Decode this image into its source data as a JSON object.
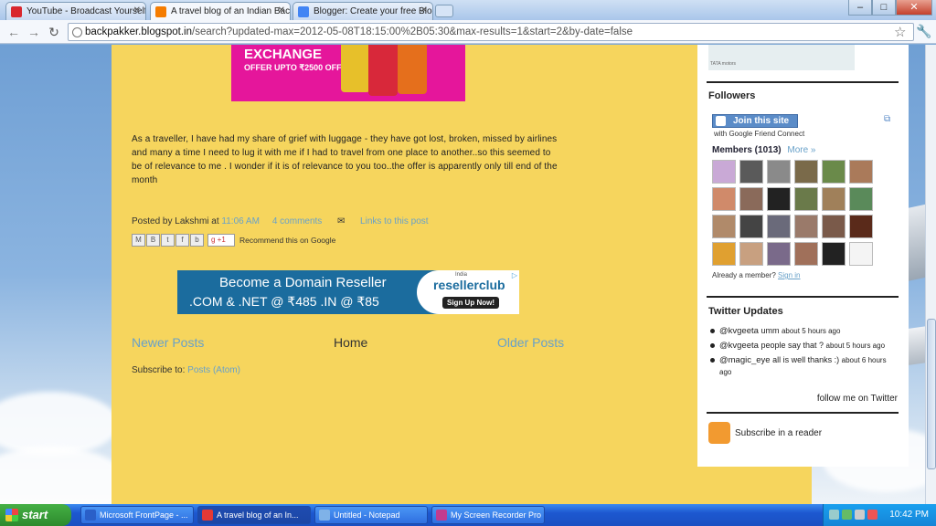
{
  "browser": {
    "tabs": [
      {
        "label": "YouTube - Broadcast Yourself",
        "color": "#d9272e"
      },
      {
        "label": "A travel blog of an Indian Backpacker",
        "color": "#f57c00"
      },
      {
        "label": "Blogger: Create your free Blog",
        "color": "#4285f4"
      }
    ],
    "url_host": "backpakker.blogspot.in",
    "url_path": "/search?updated-max=2012-05-08T18:15:00%2B05:30&max-results=1&start=2&by-date=false",
    "win_minimize": "–",
    "win_maximize": "□",
    "win_close": "✕"
  },
  "post": {
    "ad_top_title": "EXCHANGE",
    "ad_top_offer": "OFFER UPTO ₹2500 OFF*",
    "body": "As a traveller, I have had my share of grief with luggage - they have got lost, broken, missed by airlines and many a time I need to lug it with me if I had to travel from one place to another..so this seemed to be of relevance to me . I wonder if it is of relevance to you too..the offer is apparently only till end of the month",
    "posted_by_label": "Posted by",
    "author": "Lakshmi",
    "at": "at",
    "time": "11:06 AM",
    "comments": "4 comments",
    "links_to_post": "Links to this post",
    "recommend": "Recommend this on Google",
    "gplus": "+1"
  },
  "banner": {
    "line1": "Become a Domain Reseller",
    "line2": ".COM & .NET @ ₹485   .IN @ ₹85",
    "brand": "resellerclub",
    "brand_country": "India",
    "cta": "Sign Up Now!"
  },
  "pager": {
    "newer": "Newer Posts",
    "home": "Home",
    "older": "Older Posts"
  },
  "subscribe": {
    "label": "Subscribe to:",
    "link": "Posts (Atom)"
  },
  "sidebar": {
    "tata_caption": "TATA motors",
    "followers_title": "Followers",
    "join_label": "Join this site",
    "gfc_sub": "with Google Friend Connect",
    "members_label": "Members (1013)",
    "more_label": "More »",
    "already_member": "Already a member?",
    "sign_in": "Sign in",
    "twitter_title": "Twitter Updates",
    "tweets": [
      {
        "user": "@kvgeeta",
        "text": "umm",
        "ago": "about 5 hours ago"
      },
      {
        "user": "@kvgeeta",
        "text": "people say that ?",
        "ago": "about 5 hours ago"
      },
      {
        "user": "@magic_eye",
        "text": "all is well thanks :)",
        "ago": "about 6 hours ago"
      }
    ],
    "follow_me": "follow me on Twitter",
    "subscribe_reader": "Subscribe in a reader",
    "avatar_colors": [
      "#c9a9d6",
      "#5a5a5a",
      "#8a8a8a",
      "#7a6a4a",
      "#6a8a4a",
      "#aa7a5a",
      "#d08a6a",
      "#8a6a5a",
      "#222222",
      "#6a7a4a",
      "#a0805a",
      "#5a8a5a",
      "#b08a6a",
      "#444444",
      "#6a6a7a",
      "#9a7a6a",
      "#7a5a4a",
      "#5a2a1a",
      "#e0a030",
      "#c8a080",
      "#7a6a8a",
      "#a0705a",
      "#222222",
      "#f4f4f4"
    ]
  },
  "taskbar": {
    "start": "start",
    "tasks": [
      {
        "label": "Microsoft FrontPage - ...",
        "color": "#2a5fc8"
      },
      {
        "label": "A travel blog of an In...",
        "color": "#e53935"
      },
      {
        "label": "Untitled - Notepad",
        "color": "#7fb2e8"
      },
      {
        "label": "My Screen Recorder Pro",
        "color": "#c23b8f"
      }
    ],
    "clock": "10:42 PM"
  }
}
